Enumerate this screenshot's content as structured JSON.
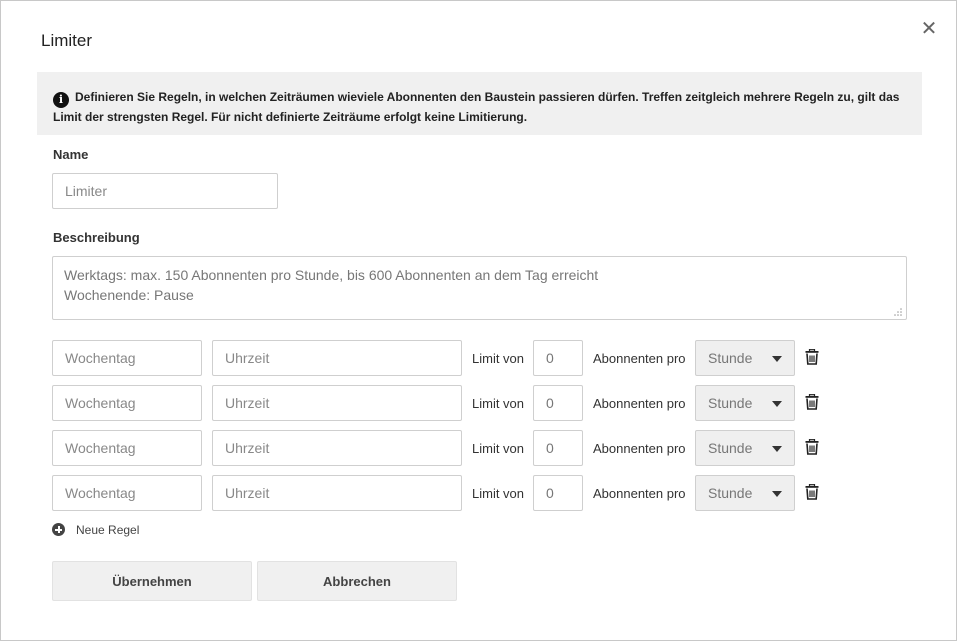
{
  "dialog": {
    "title": "Limiter",
    "close_symbol": "✕"
  },
  "info": {
    "icon": "i",
    "text": "Definieren Sie Regeln, in welchen Zeiträumen wieviele Abonnenten den Baustein passieren dürfen. Treffen zeitgleich mehrere Regeln zu, gilt das Limit der strengsten Regel. Für nicht definierte Zeiträume erfolgt keine Limitierung."
  },
  "name": {
    "label": "Name",
    "placeholder": "Limiter"
  },
  "description": {
    "label": "Beschreibung",
    "value": "Werktags: max. 150 Abonnenten pro Stunde, bis 600 Abonnenten an dem Tag erreicht\nWochenende: Pause"
  },
  "rules": [
    {
      "weekday_placeholder": "Wochentag",
      "time_placeholder": "Uhrzeit",
      "limit_label": "Limit von",
      "limit_value": "0",
      "per_label": "Abonnenten pro",
      "unit": "Stunde"
    },
    {
      "weekday_placeholder": "Wochentag",
      "time_placeholder": "Uhrzeit",
      "limit_label": "Limit von",
      "limit_value": "0",
      "per_label": "Abonnenten pro",
      "unit": "Stunde"
    },
    {
      "weekday_placeholder": "Wochentag",
      "time_placeholder": "Uhrzeit",
      "limit_label": "Limit von",
      "limit_value": "0",
      "per_label": "Abonnenten pro",
      "unit": "Stunde"
    },
    {
      "weekday_placeholder": "Wochentag",
      "time_placeholder": "Uhrzeit",
      "limit_label": "Limit von",
      "limit_value": "0",
      "per_label": "Abonnenten pro",
      "unit": "Stunde"
    }
  ],
  "add_rule": {
    "label": "Neue Regel"
  },
  "buttons": {
    "apply": "Übernehmen",
    "cancel": "Abbrechen"
  }
}
